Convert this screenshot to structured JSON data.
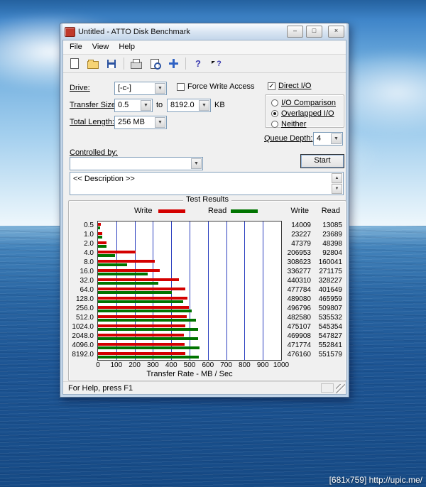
{
  "desktop": {
    "watermark": "[681x759] http://upic.me/"
  },
  "window": {
    "title": "Untitled - ATTO Disk Benchmark",
    "buttons": {
      "minimize": "–",
      "maximize": "□",
      "close": "×"
    },
    "menu": {
      "file": "File",
      "view": "View",
      "help": "Help"
    },
    "statusbar": "For Help, press F1"
  },
  "toolbar": {
    "icons": [
      "new",
      "open",
      "save",
      "print",
      "print-preview",
      "pan",
      "help",
      "context-help"
    ]
  },
  "form": {
    "drive": {
      "label": "Drive:",
      "value": "[-c-]"
    },
    "force_write_access": {
      "label": "Force Write Access",
      "checked": false
    },
    "direct_io": {
      "label": "Direct I/O",
      "checked": true
    },
    "transfer_size": {
      "label": "Transfer Size:",
      "from": "0.5",
      "to_label": "to",
      "to": "8192.0",
      "unit": "KB"
    },
    "total_length": {
      "label": "Total Length:",
      "value": "256 MB"
    },
    "io_mode": {
      "options": [
        "I/O Comparison",
        "Overlapped I/O",
        "Neither"
      ],
      "selected": "Overlapped I/O"
    },
    "queue_depth": {
      "label": "Queue Depth:",
      "value": "4"
    },
    "controlled_by": {
      "label": "Controlled by:",
      "value": ""
    },
    "start_button": "Start",
    "description": "<< Description >>"
  },
  "results": {
    "group_title": "Test Results",
    "legend": {
      "write": "Write",
      "read": "Read"
    },
    "columns": {
      "write": "Write",
      "read": "Read"
    }
  },
  "chart_data": {
    "type": "bar",
    "title": "Test Results",
    "xlabel": "Transfer Rate - MB / Sec",
    "xlim": [
      0,
      1000
    ],
    "x_ticks": [
      0,
      100,
      200,
      300,
      400,
      500,
      600,
      700,
      800,
      900,
      1000
    ],
    "categories": [
      "0.5",
      "1.0",
      "2.0",
      "4.0",
      "8.0",
      "16.0",
      "32.0",
      "64.0",
      "128.0",
      "256.0",
      "512.0",
      "1024.0",
      "2048.0",
      "4096.0",
      "8192.0"
    ],
    "series": [
      {
        "name": "Write",
        "color": "#d40000",
        "values": [
          14009,
          23227,
          47379,
          206953,
          308623,
          336277,
          440310,
          477784,
          489080,
          496796,
          482580,
          475107,
          469908,
          471774,
          476160
        ]
      },
      {
        "name": "Read",
        "color": "#007400",
        "values": [
          13085,
          23689,
          48398,
          92804,
          160041,
          271175,
          328227,
          401649,
          465959,
          509807,
          535532,
          545354,
          547827,
          552841,
          551579
        ]
      }
    ],
    "grid": true,
    "legend_position": "top"
  }
}
